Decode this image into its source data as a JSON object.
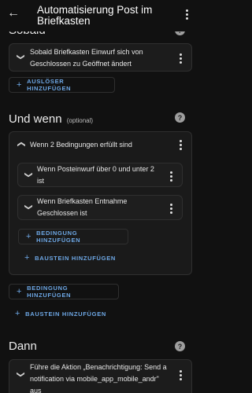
{
  "header": {
    "title": "Automatisierung Post im Briefkasten"
  },
  "sobald": {
    "title": "Sobald",
    "trigger_text": "Sobald Briefkasten Einwurf sich von Geschlossen zu Geöffnet ändert",
    "add_trigger_label": "AUSLÖSER HINZUFÜGEN"
  },
  "und_wenn": {
    "title": "Und wenn",
    "optional_label": "(optional)",
    "group_title": "Wenn 2 Bedingungen erfüllt sind",
    "conditions": [
      {
        "text": "Wenn Posteinwurf über 0 und unter 2 ist"
      },
      {
        "text": "Wenn Briefkasten Entnahme Geschlossen ist"
      }
    ],
    "add_condition_inner_label": "BEDINGUNG HINZUFÜGEN",
    "add_block_inner_label": "BAUSTEIN HINZUFÜGEN",
    "add_condition_label": "BEDINGUNG HINZUFÜGEN",
    "add_block_label": "BAUSTEIN HINZUFÜGEN"
  },
  "dann": {
    "title": "Dann",
    "action_text": "Führe die Aktion „Benachrichtigung: Send a notification via mobile_app_mobile_andr\" aus"
  },
  "icons": {
    "back": "arrow-left-icon",
    "overflow": "dots-vertical-icon",
    "help": "help-circle-icon",
    "chevron": "chevron-icon",
    "plus": "plus-icon"
  },
  "colors": {
    "background": "#111111",
    "card": "#1c1c1c",
    "accent": "#6ea8e6"
  }
}
